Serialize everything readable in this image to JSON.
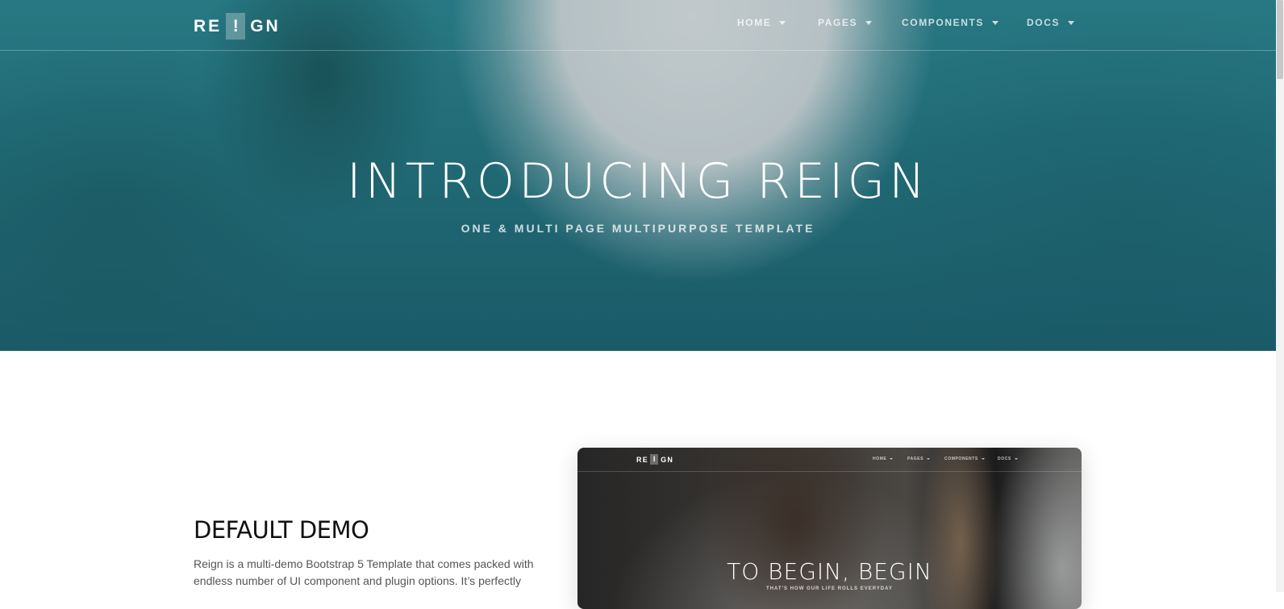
{
  "brand": {
    "logo_left": "RE",
    "logo_mid": "!",
    "logo_right": "GN"
  },
  "nav": {
    "items": [
      {
        "label": "HOME"
      },
      {
        "label": "PAGES"
      },
      {
        "label": "COMPONENTS"
      },
      {
        "label": "DOCS"
      }
    ],
    "dropdown_icon": "caret-down-icon"
  },
  "hero": {
    "title": "INTRODUCING REIGN",
    "subtitle": "ONE & MULTI PAGE MULTIPURPOSE TEMPLATE"
  },
  "demo": {
    "title": "DEFAULT DEMO",
    "description": "Reign is a multi-demo Bootstrap 5 Template that comes packed with endless number of UI component and plugin options. It’s perfectly",
    "preview": {
      "logo_left": "RE",
      "logo_mid": "I",
      "logo_right": "GN",
      "menu": [
        "HOME",
        "PAGES",
        "COMPONENTS",
        "DOCS"
      ],
      "title": "TO BEGIN, BEGIN",
      "subtitle": "THAT'S HOW OUR LIFE ROLLS EVERYDAY"
    }
  },
  "colors": {
    "hero_teal": "#23717d",
    "sand": "#dcdfe0",
    "heading_text": "#111111",
    "body_text": "#555555"
  }
}
